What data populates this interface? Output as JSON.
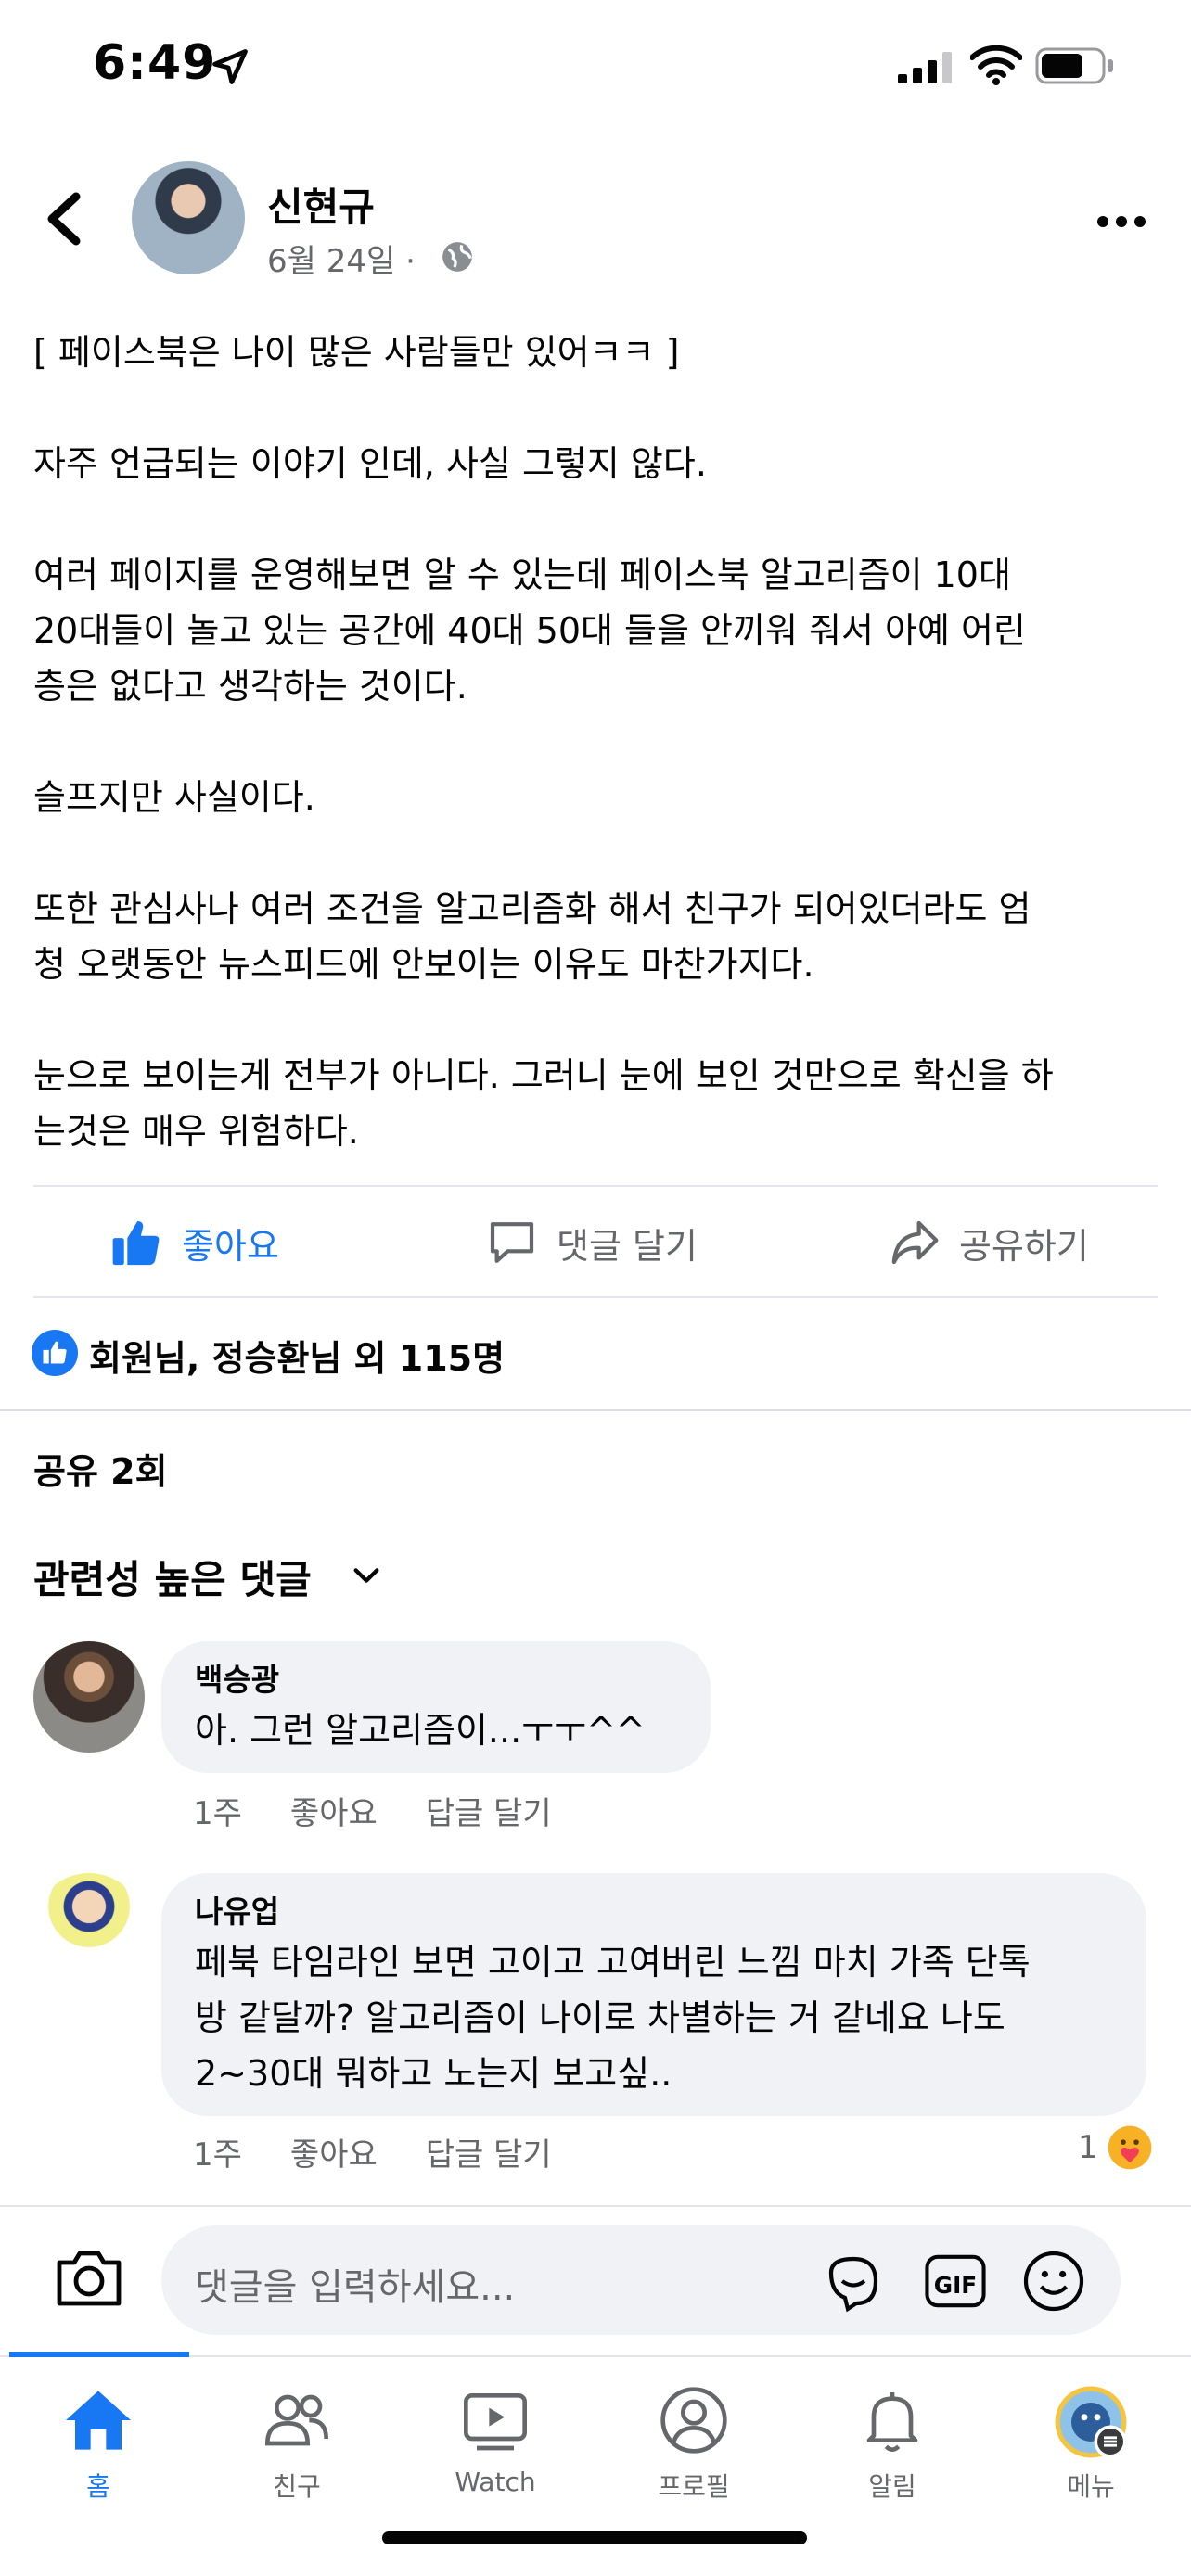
{
  "status_bar": {
    "time": "6:49"
  },
  "post": {
    "author": "신현규",
    "date": "6월 24일 ·",
    "body": "[ 페이스북은 나이 많은 사람들만 있어ㅋㅋ ]\n\n자주 언급되는 이야기 인데, 사실 그렇지 않다.\n\n여러 페이지를 운영해보면 알 수 있는데 페이스북 알고리즘이 10대\n20대들이 놀고 있는 공간에 40대 50대 들을 안끼워 줘서 아예 어린\n층은 없다고 생각하는 것이다.\n\n슬프지만 사실이다.\n\n또한 관심사나 여러 조건을 알고리즘화 해서 친구가 되어있더라도 엄\n청 오랫동안 뉴스피드에 안보이는 이유도 마찬가지다.\n\n눈으로 보이는게 전부가 아니다. 그러니 눈에 보인 것만으로 확신을 하\n는것은 매우 위험하다."
  },
  "actions": {
    "like": "좋아요",
    "comment": "댓글 달기",
    "share": "공유하기"
  },
  "reactions": {
    "summary": "회원님, 정승환님 외 115명"
  },
  "shares": "공유 2회",
  "comments_sort": "관련성 높은 댓글",
  "comments": [
    {
      "name": "백승광",
      "text": "아. 그런 알고리즘이...ㅜㅜ^^",
      "time": "1주",
      "like": "좋아요",
      "reply": "답글 달기"
    },
    {
      "name": "나유업",
      "text": "페북 타임라인 보면 고이고 고여버린 느낌 마치 가족 단톡\n방 같달까? 알고리즘이 나이로 차별하는 거 같네요 나도\n2~30대 뭐하고 노는지 보고싶..",
      "time": "1주",
      "like": "좋아요",
      "reply": "답글 달기",
      "reaction_count": "1"
    }
  ],
  "composer": {
    "placeholder": "댓글을 입력하세요..."
  },
  "tabs": [
    {
      "label": "홈",
      "icon": "home-icon"
    },
    {
      "label": "친구",
      "icon": "friends-icon"
    },
    {
      "label": "Watch",
      "icon": "watch-icon"
    },
    {
      "label": "프로필",
      "icon": "profile-icon"
    },
    {
      "label": "알림",
      "icon": "bell-icon"
    },
    {
      "label": "메뉴",
      "icon": "menu-avatar"
    }
  ],
  "colors": {
    "brand": "#1877f2",
    "secondary_text": "#65676b",
    "bubble": "#f0f2f5"
  }
}
